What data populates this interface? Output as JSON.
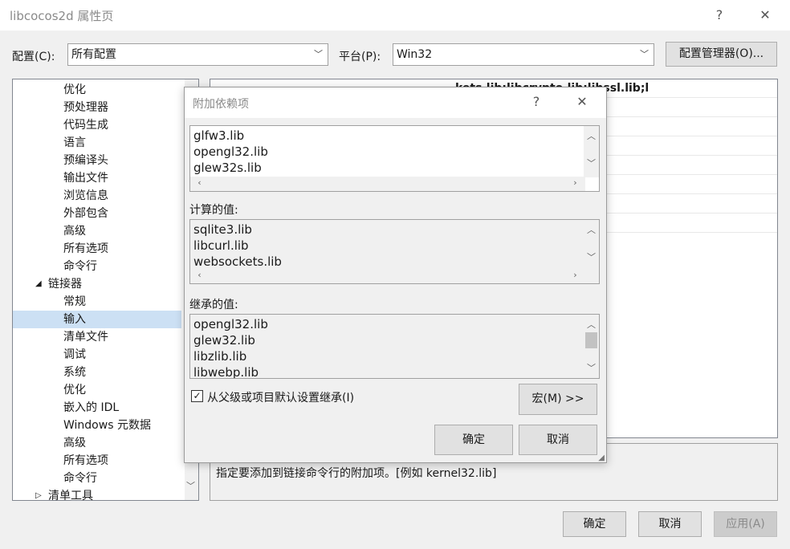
{
  "window": {
    "title": "libcocos2d 属性页",
    "help": "?",
    "close": "✕"
  },
  "toolbar": {
    "config_label": "配置(C):",
    "config_value": "所有配置",
    "platform_label": "平台(P):",
    "platform_value": "Win32",
    "config_manager": "配置管理器(O)..."
  },
  "tree": {
    "items": [
      {
        "label": "优化",
        "indent": 2
      },
      {
        "label": "预处理器",
        "indent": 2
      },
      {
        "label": "代码生成",
        "indent": 2
      },
      {
        "label": "语言",
        "indent": 2
      },
      {
        "label": "预编译头",
        "indent": 2
      },
      {
        "label": "输出文件",
        "indent": 2
      },
      {
        "label": "浏览信息",
        "indent": 2
      },
      {
        "label": "外部包含",
        "indent": 2
      },
      {
        "label": "高级",
        "indent": 2
      },
      {
        "label": "所有选项",
        "indent": 2
      },
      {
        "label": "命令行",
        "indent": 2
      },
      {
        "label": "链接器",
        "indent": 1,
        "expander": "◢"
      },
      {
        "label": "常规",
        "indent": 2
      },
      {
        "label": "输入",
        "indent": 2,
        "selected": true
      },
      {
        "label": "清单文件",
        "indent": 2
      },
      {
        "label": "调试",
        "indent": 2
      },
      {
        "label": "系统",
        "indent": 2
      },
      {
        "label": "优化",
        "indent": 2
      },
      {
        "label": "嵌入的 IDL",
        "indent": 2
      },
      {
        "label": "Windows 元数据",
        "indent": 2
      },
      {
        "label": "高级",
        "indent": 2
      },
      {
        "label": "所有选项",
        "indent": 2
      },
      {
        "label": "命令行",
        "indent": 2
      },
      {
        "label": "清单工具",
        "indent": 1,
        "expander": "▷"
      }
    ]
  },
  "grid": {
    "first_row_value": "kets.lib;libcrypto.lib;libssl.lib;l"
  },
  "description": {
    "text": "指定要添加到链接命令行的附加项。[例如 kernel32.lib]"
  },
  "footer": {
    "ok": "确定",
    "cancel": "取消",
    "apply": "应用(A)"
  },
  "dialog": {
    "title": "附加依赖项",
    "help": "?",
    "close": "✕",
    "edit_lines": [
      "glfw3.lib",
      "opengl32.lib",
      "glew32s.lib"
    ],
    "computed_label": "计算的值:",
    "computed_lines": [
      "sqlite3.lib",
      "libcurl.lib",
      "websockets.lib"
    ],
    "inherited_label": "继承的值:",
    "inherited_lines": [
      "opengl32.lib",
      "glew32.lib",
      "libzlib.lib",
      "libwebp.lib"
    ],
    "inherit_checkbox": "从父级或项目默认设置继承(I)",
    "inherit_checked": true,
    "macro_button": "宏(M) >>",
    "ok": "确定",
    "cancel": "取消"
  }
}
